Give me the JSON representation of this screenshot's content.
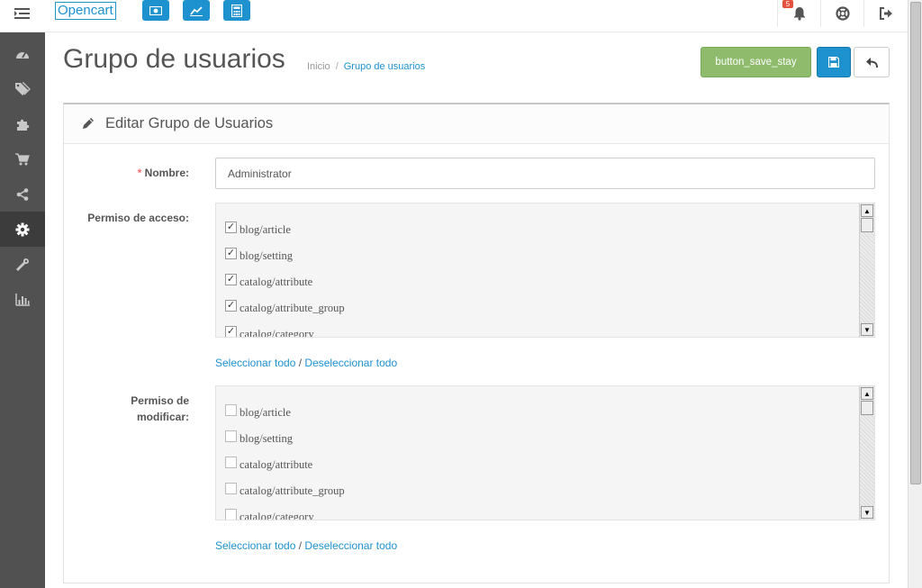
{
  "header": {
    "logo": "Opencart",
    "notification_count": "5"
  },
  "sidebar": {
    "items": [
      {
        "icon": "dashboard-icon"
      },
      {
        "icon": "tags-icon"
      },
      {
        "icon": "puzzle-icon"
      },
      {
        "icon": "cart-icon"
      },
      {
        "icon": "share-icon"
      },
      {
        "icon": "gear-icon"
      },
      {
        "icon": "wrench-icon"
      },
      {
        "icon": "bar-chart-icon"
      }
    ]
  },
  "page": {
    "title": "Grupo de usuarios",
    "breadcrumb": [
      "Inicio",
      "Grupo de usuarios"
    ],
    "save_stay_label": "button_save_stay"
  },
  "panel": {
    "heading": "Editar Grupo de Usuarios"
  },
  "form": {
    "name_label": "Nombre:",
    "name_required": "*",
    "name_value": "Administrator",
    "access_label": "Permiso de acceso:",
    "modify_label_line1": "Permiso de",
    "modify_label_line2": "modificar:",
    "access_permissions": [
      {
        "label": "blog/article",
        "checked": true
      },
      {
        "label": "blog/setting",
        "checked": true
      },
      {
        "label": "catalog/attribute",
        "checked": true
      },
      {
        "label": "catalog/attribute_group",
        "checked": true
      },
      {
        "label": "catalog/category",
        "checked": true
      }
    ],
    "modify_permissions": [
      {
        "label": "blog/article",
        "checked": false
      },
      {
        "label": "blog/setting",
        "checked": false
      },
      {
        "label": "catalog/attribute",
        "checked": false
      },
      {
        "label": "catalog/attribute_group",
        "checked": false
      },
      {
        "label": "catalog/category",
        "checked": false
      }
    ],
    "select_all": "Seleccionar todo",
    "separator": "/",
    "deselect_all": "Deseleccionar todo"
  }
}
